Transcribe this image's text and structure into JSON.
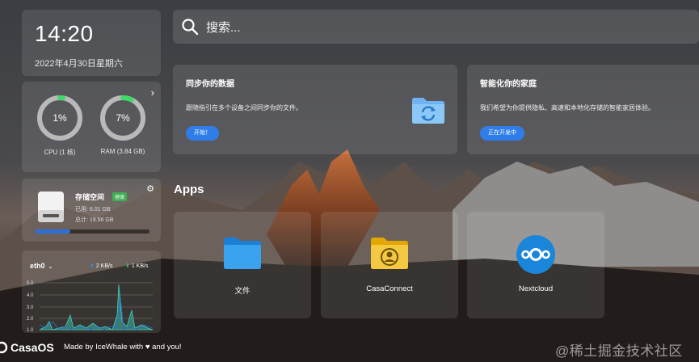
{
  "clock": {
    "time": "14:20",
    "date": "2022年4月30日星期六"
  },
  "system": {
    "cpu": {
      "percent": 1,
      "display": "1%",
      "label": "CPU (1 核)"
    },
    "ram": {
      "percent": 7,
      "display": "7%",
      "label": "RAM (3.84 GB)"
    }
  },
  "storage": {
    "title": "存储空间",
    "badge": "健康",
    "used": "已用: 6.01 GB",
    "total": "总计: 19.56 GB",
    "used_fraction": 0.307
  },
  "network": {
    "interface": "eth0",
    "upload": "2 KB/s",
    "download": "1 KB/s",
    "y_ticks": [
      "5.0",
      "4.0",
      "3.0",
      "2.0",
      "1.0"
    ]
  },
  "search": {
    "placeholder": "搜索..."
  },
  "cards": [
    {
      "title": "同步你的数据",
      "description": "跟随指引在多个设备之间同步你的文件。",
      "button": "开始！"
    },
    {
      "title": "智能化你的家庭",
      "description": "我们希望为你提供隐私、高速和本地化存储的智能家居体验。",
      "button": "正在开发中"
    }
  ],
  "apps": {
    "title": "Apps",
    "items": [
      {
        "name": "文件",
        "icon": "folder-icon"
      },
      {
        "name": "CasaConnect",
        "icon": "casaconnect-icon"
      },
      {
        "name": "Nextcloud",
        "icon": "nextcloud-icon"
      }
    ]
  },
  "footer": {
    "brand": "CasaOS",
    "made_by": "Made by IceWhale with ♥ and you!",
    "watermark": "@稀土掘金技术社区"
  },
  "colors": {
    "accent": "#2f7de8",
    "gauge_green": "#3ddc6a",
    "storage_bar": "#2f6fd6",
    "badge_green": "#3fae55"
  }
}
